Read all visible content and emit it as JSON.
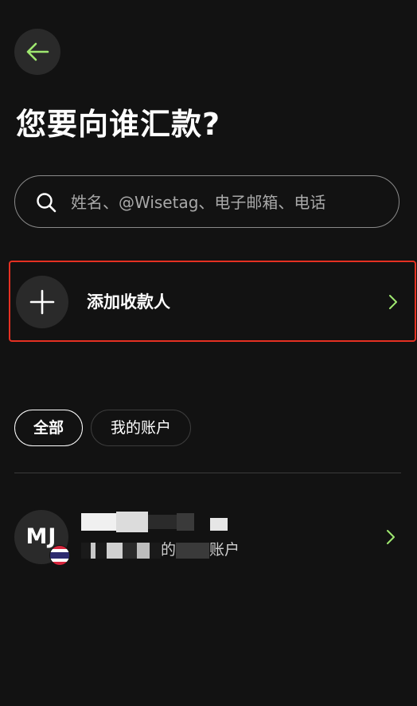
{
  "header": {
    "back_icon": "arrow-left-icon",
    "title": "您要向谁汇款?"
  },
  "search": {
    "placeholder": "姓名、@Wisetag、电子邮箱、电话",
    "icon": "search-icon"
  },
  "add_recipient": {
    "icon": "plus-icon",
    "label": "添加收款人",
    "chevron_icon": "chevron-right-icon"
  },
  "filters": [
    {
      "label": "全部",
      "active": true
    },
    {
      "label": "我的账户",
      "active": false
    }
  ],
  "recipients": [
    {
      "initials": "MJ",
      "flag_icon": "thailand-flag-icon",
      "name": "",
      "subtitle_prefix": "",
      "subtitle_middle": "的",
      "subtitle_suffix": "账户",
      "chevron_icon": "chevron-right-icon"
    }
  ],
  "colors": {
    "background": "#121212",
    "accent": "#9fe870",
    "highlight_border": "#e53022"
  }
}
